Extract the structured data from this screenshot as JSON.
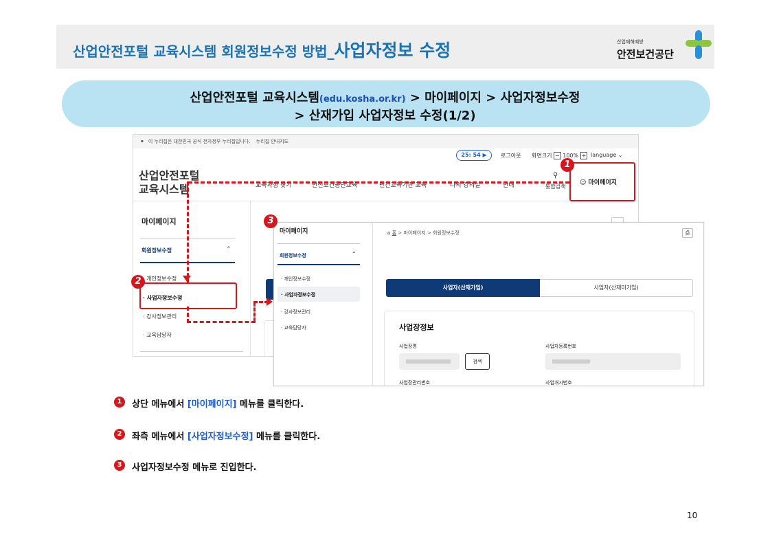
{
  "header": {
    "title_prefix": "산업안전포털 교육시스템 회원정보수정 방법_",
    "title_emphasis": "사업자정보 수정",
    "logo_small": "산업재해예방",
    "logo_name": "안전보건공단"
  },
  "subtitle": {
    "line1_a": "산업안전포털 교육시스템",
    "line1_url": "(edu.kosha.or.kr)",
    "line1_b": " > 마이페이지 > 사업자정보수정",
    "line2": "> 산재가입 사업자정보 수정(1/2)"
  },
  "screen1": {
    "gov_notice": "이 누리집은 대한민국 공식 전자정부 누리집입니다.",
    "gov_link": "누리집 안내지도",
    "timer": "25: 54",
    "logout": "로그아웃",
    "zoom_label": "화면크기",
    "zoom_value": "100%",
    "language": "language",
    "site_title_1": "산업안전포털",
    "site_title_2": "교육시스템",
    "nav": [
      "교육과정 찾기",
      "안전보건공단교육",
      "민간교육기관 교육",
      "나의 강의실",
      "안내"
    ],
    "search_label": "통합검색",
    "mypage_label": "마이페이지",
    "side_title": "마이페이지",
    "side_group": "회원정보수정",
    "side_items": [
      "개인정보수정",
      "사업자정보수정",
      "강사정보관리",
      "교육담당자"
    ]
  },
  "screen2": {
    "side_title": "마이페이지",
    "side_group": "회원정보수정",
    "side_items": [
      "개인정보수정",
      "사업자정보수정",
      "강사정보관리",
      "교육담당자"
    ],
    "breadcrumb": [
      "홈",
      "마이페이지",
      "회원정보수정"
    ],
    "tabs": [
      "사업자(산재가입)",
      "사업자(산재미가입)"
    ],
    "section_title": "사업장정보",
    "fields": [
      "사업장명",
      "사업자등록번호",
      "사업장관리번호",
      "사업개시번호"
    ],
    "search_button": "검색"
  },
  "badges": [
    "1",
    "2",
    "3"
  ],
  "steps": [
    {
      "num": "1",
      "a": "상단 메뉴에서 ",
      "hl": "[마이페이지]",
      "b": " 메뉴를 클릭한다."
    },
    {
      "num": "2",
      "a": "좌측 메뉴에서 ",
      "hl": "[사업자정보수정]",
      "b": " 메뉴를 클릭한다."
    },
    {
      "num": "3",
      "a": "사업자정보수정 메뉴로 진입한다.",
      "hl": "",
      "b": ""
    }
  ],
  "page_number": "10",
  "colors": {
    "title": "#1a73b5",
    "pill": "#b9e3f3",
    "accent_red": "#d8151b",
    "tab_active": "#0f3a78",
    "highlight": "#1a5ed8"
  }
}
